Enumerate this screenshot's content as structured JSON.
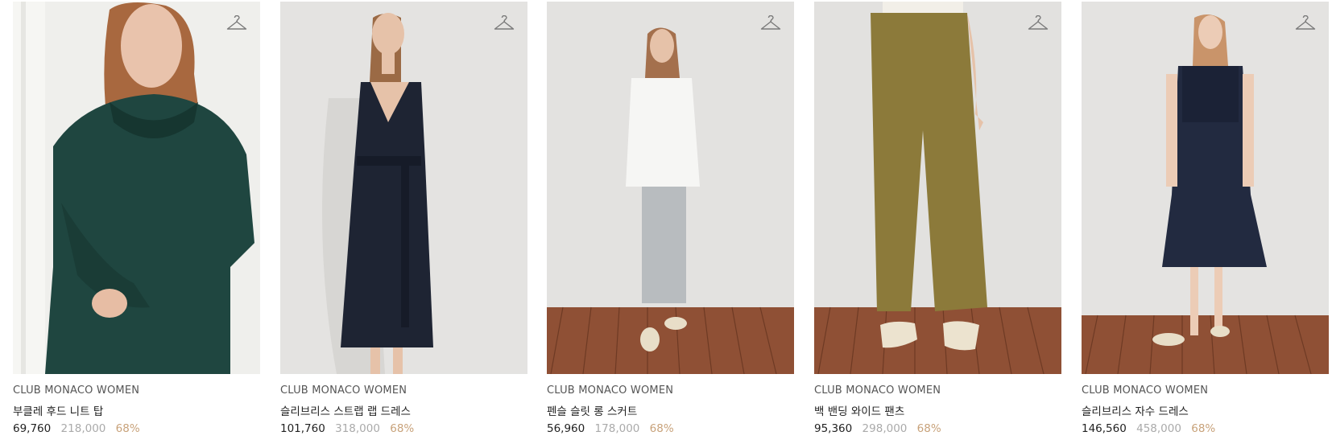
{
  "products": [
    {
      "brand": "CLUB MONACO WOMEN",
      "name": "부클레 후드 니트 탑",
      "price": "69,760",
      "original_price": "218,000",
      "discount": "68%",
      "icon": "hanger-icon"
    },
    {
      "brand": "CLUB MONACO WOMEN",
      "name": "슬리브리스 스트랩 랩 드레스",
      "price": "101,760",
      "original_price": "318,000",
      "discount": "68%",
      "icon": "hanger-icon"
    },
    {
      "brand": "CLUB MONACO WOMEN",
      "name": "펜슬 슬릿 롱 스커트",
      "price": "56,960",
      "original_price": "178,000",
      "discount": "68%",
      "icon": "hanger-icon"
    },
    {
      "brand": "CLUB MONACO WOMEN",
      "name": "백 밴딩 와이드 팬츠",
      "price": "95,360",
      "original_price": "298,000",
      "discount": "68%",
      "icon": "hanger-icon"
    },
    {
      "brand": "CLUB MONACO WOMEN",
      "name": "슬리브리스 자수 드레스",
      "price": "146,560",
      "original_price": "458,000",
      "discount": "68%",
      "icon": "hanger-icon"
    }
  ],
  "colors": {
    "discount": "#c8a27a",
    "original_price": "#aaaaaa",
    "price": "#222222",
    "photo_background": "#ebe9e6",
    "floor": "#9b5a3c"
  }
}
